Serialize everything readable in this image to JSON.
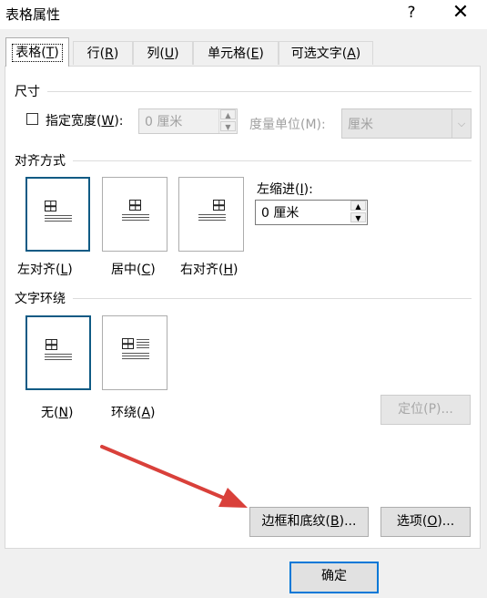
{
  "window": {
    "title": "表格属性",
    "help_glyph": "?",
    "close_glyph": "✕"
  },
  "tabs": [
    {
      "label": "表格(",
      "key": "T",
      "suffix": ")",
      "active": true
    },
    {
      "label": "行(",
      "key": "R",
      "suffix": ")",
      "active": false
    },
    {
      "label": "列(",
      "key": "U",
      "suffix": ")",
      "active": false
    },
    {
      "label": "单元格(",
      "key": "E",
      "suffix": ")",
      "active": false
    },
    {
      "label": "可选文字(",
      "key": "A",
      "suffix": ")",
      "active": false
    }
  ],
  "size": {
    "section_title": "尺寸",
    "preferred_width": {
      "label": "指定宽度(",
      "key": "W",
      "suffix": "):",
      "checked": false
    },
    "width_value": "0 厘米",
    "measure_label": "度量单位(M):",
    "measure_value": "厘米"
  },
  "alignment": {
    "section_title": "对齐方式",
    "options": [
      {
        "label": "左对齐(",
        "key": "L",
        "suffix": ")",
        "icon": "table-align-left-icon",
        "selected": true
      },
      {
        "label": "居中(",
        "key": "C",
        "suffix": ")",
        "icon": "table-align-center-icon",
        "selected": false
      },
      {
        "label": "右对齐(",
        "key": "H",
        "suffix": ")",
        "icon": "table-align-right-icon",
        "selected": false
      }
    ],
    "indent_label": "左缩进(",
    "indent_key": "I",
    "indent_suffix": "):",
    "indent_value": "0 厘米"
  },
  "text_wrapping": {
    "section_title": "文字环绕",
    "options": [
      {
        "label": "无(",
        "key": "N",
        "suffix": ")",
        "icon": "wrap-none-icon",
        "selected": true
      },
      {
        "label": "环绕(",
        "key": "A",
        "suffix": ")",
        "icon": "wrap-around-icon",
        "selected": false
      }
    ],
    "position_button": "定位(P)..."
  },
  "buttons": {
    "borders": {
      "label": "边框和底纹(",
      "key": "B",
      "suffix": ")..."
    },
    "options": {
      "label": "选项(",
      "key": "O",
      "suffix": ")..."
    },
    "ok": "确定"
  },
  "colors": {
    "selected_border": "#0f5a84",
    "default_button_border": "#0078d7",
    "annotation_arrow": "#d9403a"
  }
}
